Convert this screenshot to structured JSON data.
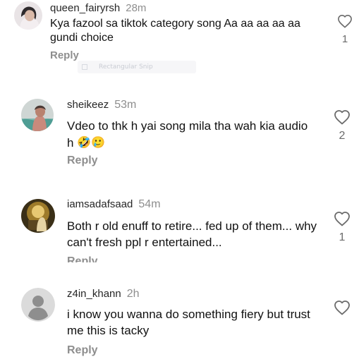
{
  "comments": [
    {
      "username": "queen_fairyrsh",
      "time": "28m",
      "text": "Kya fazool sa tiktok category song Aa aa aa aa aa gundi choice",
      "reply": "Reply",
      "likes": "1"
    },
    {
      "username": "sheikeez",
      "time": "53m",
      "text": "Vdeo to thk h yai song mila tha wah kia audio h",
      "emojis": "🤣🥲",
      "reply": "Reply",
      "likes": "2"
    },
    {
      "username": "iamsadafsaad",
      "time": "54m",
      "text": "Both r old enuff to retire... fed up of them... why can't fresh ppl r entertained...",
      "reply": "Reply",
      "likes": "1"
    },
    {
      "username": "z4in_khann",
      "time": "2h",
      "text": "i know you wanna do something fiery but trust me this is tacky",
      "reply": "Reply",
      "likes": ""
    }
  ],
  "overlay": {
    "label": "Rectangular Snip"
  },
  "icons": {
    "like": "heart-outline-icon",
    "default_avatar": "default-avatar-icon"
  },
  "colors": {
    "username": "#262626",
    "secondary": "#8e8e8e",
    "heart_stroke": "#6b6b6b"
  }
}
